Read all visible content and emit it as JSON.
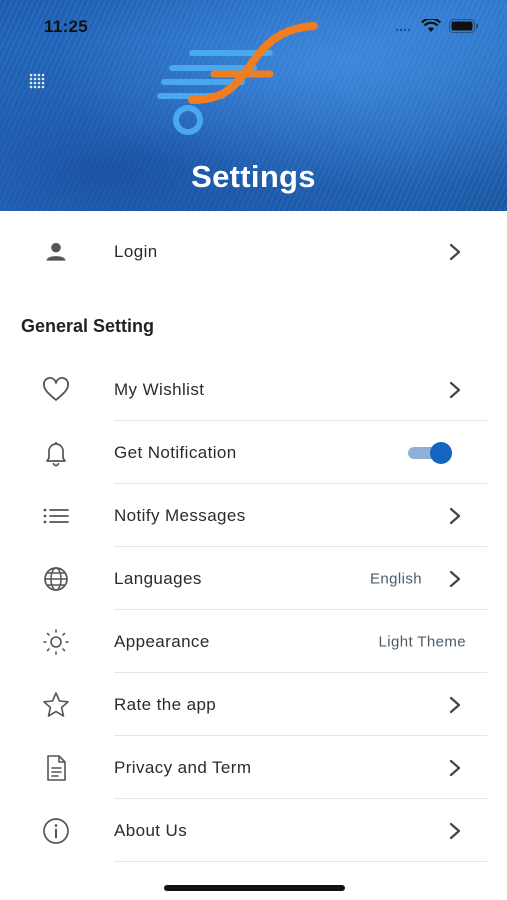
{
  "status_bar": {
    "time": "11:25"
  },
  "header": {
    "title": "Settings"
  },
  "login": {
    "label": "Login"
  },
  "general": {
    "section_title": "General Setting",
    "items": [
      {
        "label": "My Wishlist",
        "icon": "heart-icon"
      },
      {
        "label": "Get Notification",
        "icon": "bell-icon",
        "toggle_on": true
      },
      {
        "label": "Notify Messages",
        "icon": "list-icon"
      },
      {
        "label": "Languages",
        "icon": "globe-icon",
        "value": "English"
      },
      {
        "label": "Appearance",
        "icon": "sun-icon",
        "value": "Light Theme"
      },
      {
        "label": "Rate the app",
        "icon": "star-icon"
      },
      {
        "label": "Privacy and Term",
        "icon": "document-icon"
      },
      {
        "label": "About Us",
        "icon": "info-icon"
      }
    ]
  },
  "colors": {
    "header_blue": "#1d5fb4",
    "toggle_knob": "#1565c0",
    "toggle_track": "#8fb0d4",
    "logo_orange": "#f07d1f",
    "logo_light_blue": "#4aa8ee"
  }
}
